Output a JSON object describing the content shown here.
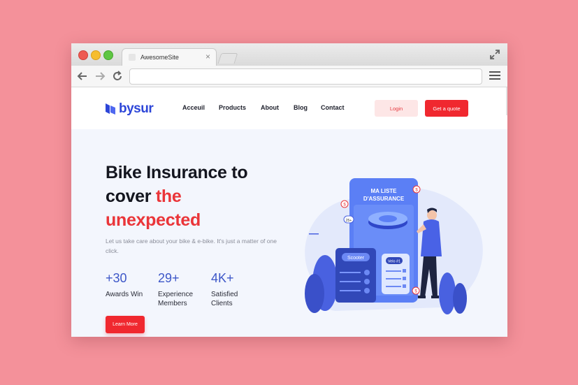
{
  "browser": {
    "tab_title": "AwesomeSite",
    "tab_close": "×",
    "url": ""
  },
  "site": {
    "logo_text": "bysur",
    "nav": [
      "Acceuil",
      "Products",
      "About",
      "Blog",
      "Contact"
    ],
    "login_label": "Login",
    "quote_label": "Get a quote"
  },
  "hero": {
    "headline_1": "Bike Insurance to",
    "headline_2": "cover ",
    "headline_2_red": "the",
    "headline_3_red": "unexpected",
    "subtext": "Let us take care about your bike & e-bike. It's just a matter of one click.",
    "stats": [
      {
        "value": "+30",
        "label": "Awards Win"
      },
      {
        "value": "29+",
        "label": "Experience Members"
      },
      {
        "value": "4K+",
        "label": "Satisfied Clients"
      }
    ],
    "cta_label": "Learn More"
  },
  "illustration": {
    "card_title": "MA LISTE D'ASSURANCE",
    "scooter_label": "Scooter",
    "velo_label": "Velo #1",
    "percent_label": "25+",
    "coin_symbol": "$"
  },
  "colors": {
    "background": "#f4919a",
    "brand_blue": "#2d46d8",
    "accent_red": "#f0282f",
    "stat_blue": "#3d57c8"
  }
}
